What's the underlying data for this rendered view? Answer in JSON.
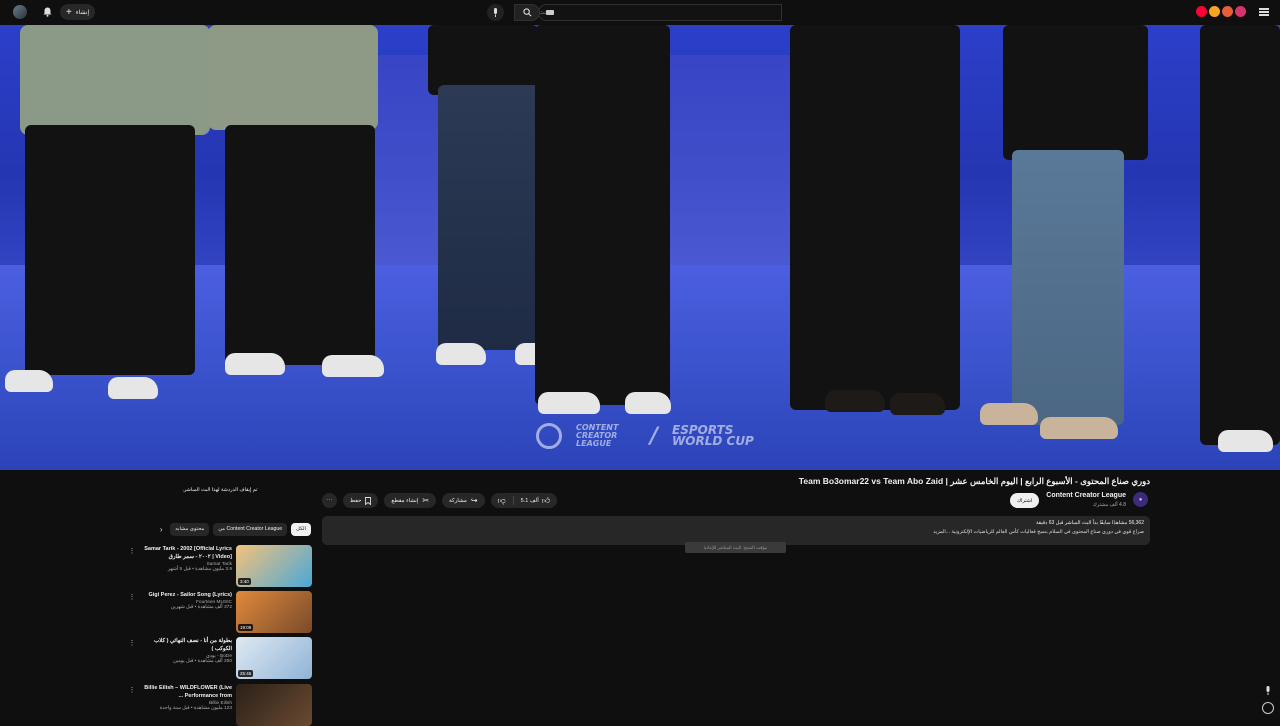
{
  "topbar": {
    "create_label": "إنشاء",
    "search_placeholder": "بحث"
  },
  "video": {
    "title": "دوري صناع المحتوى - الأسبوع الرابع | اليوم الخامس عشر | Team Bo3omar22 vs Team Abo Zaid",
    "watermark_brand1": "CONTENT CREATOR LEAGUE",
    "watermark_brand2": "ESPORTS WORLD CUP"
  },
  "channel": {
    "name": "Content Creator League",
    "subscribers": "4.8 ألف مشترك",
    "subscribe_label": "اشتراك"
  },
  "actions": {
    "likes": "5.1 ألف",
    "share": "مشاركة",
    "clip": "إنشاء مقطع",
    "save": "حفظ"
  },
  "description": {
    "stats": "56,362 مشاهدًا سابقًا بدأ البث المباشر قبل 63 دقيقة",
    "text": "صراع قوي في دوري صناع المحتوى في السلام بنسخ فعاليات كأس العالم للرياضيات الإلكترونية ...المزيد",
    "tooltip": "مؤقت النسخ: البث المباشر للإعادة"
  },
  "sidebar": {
    "chat_closed": "تم إيقاف الدردشة لهذا البث المباشر.",
    "chips": [
      "الكل",
      "من Content Creator League",
      "محتوى مشابه"
    ],
    "recs": [
      {
        "title": "Samar Tarik - 2002 [Official Lyrics Video] | ٢٠٠٢ - سمر طارق",
        "channel": "Samar Tarik",
        "meta": "3.9 مليون مشاهدة • قبل 5 أشهر",
        "duration": "3:40",
        "thumb_colors": [
          "#f4c27a",
          "#4aa8d8"
        ]
      },
      {
        "title": "Gigi Perez - Sailor Song (Lyrics)",
        "channel": "Fourteen MUSIC",
        "meta": "372 ألف مشاهدة • قبل شهرين",
        "duration": "19:09",
        "thumb_colors": [
          "#e08a3c",
          "#7a4a2a"
        ]
      },
      {
        "title": "بطولة من أنا - نصف النهائي ( كلاب الكوكب )",
        "channel": "BoDe - بودي",
        "meta": "250 ألف مشاهدة • قبل يومين",
        "duration": "25:46",
        "thumb_colors": [
          "#dfe9f2",
          "#8fb4d6"
        ]
      },
      {
        "title": "Billie Eilish – WILDFLOWER (Live Performance from ...",
        "channel": "Billie Eilish",
        "meta": "123 مليون مشاهدة • قبل سنة واحدة",
        "duration": "",
        "thumb_colors": [
          "#2a2018",
          "#6a4a30"
        ]
      }
    ]
  },
  "colors": {
    "background": "#0f0f0f",
    "surface": "#272727",
    "brand_red": "#ff0033"
  }
}
